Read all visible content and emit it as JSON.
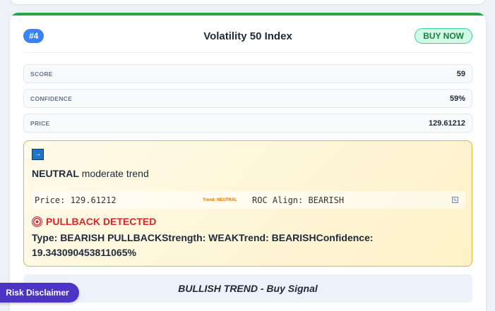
{
  "card": {
    "rank": "#4",
    "asset": "Volatility 50 Index",
    "signal_badge": "BUY NOW"
  },
  "metrics": [
    {
      "label": "SCORE",
      "value": "59"
    },
    {
      "label": "CONFIDENCE",
      "value": "59%"
    },
    {
      "label": "PRICE",
      "value": "129.61212"
    }
  ],
  "trend": {
    "icon": "right-arrow-icon",
    "state": "NEUTRAL",
    "description": "moderate trend",
    "info": {
      "price": "Price: 129.61212",
      "trend_tag": "Trend: NEUTRAL",
      "roc_align": "ROC Align: BEARISH"
    },
    "pullback_title": "PULLBACK DETECTED",
    "pullback_details": "Type: BEARISH PULLBACKStrength: WEAKTrend: BEARISHConfidence: 19.343090453811065%"
  },
  "signal_bar": "BULLISH TREND - Buy Signal",
  "disclaimer": "Risk Disclaimer",
  "colors": {
    "accent_green": "#28a745",
    "rank_blue": "#3b82f6",
    "pullback_red": "#dc2626",
    "disclaimer_purple": "#4c35c4"
  }
}
